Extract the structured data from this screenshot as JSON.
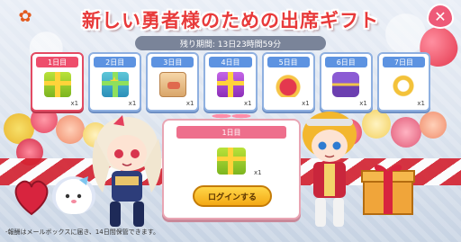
{
  "header": {
    "title": "新しい勇者様のための出席ギフト",
    "close_label": "✕"
  },
  "timer": {
    "text": "残り期間: 13日23時間59分"
  },
  "days": [
    {
      "label": "1日目",
      "qty": "x1",
      "gift": "green-gift-box",
      "active": true
    },
    {
      "label": "2日目",
      "qty": "x1",
      "gift": "teal-star-gift-box",
      "active": false
    },
    {
      "label": "3日目",
      "qty": "x1",
      "gift": "cardboard-box",
      "active": false
    },
    {
      "label": "4日目",
      "qty": "x1",
      "gift": "purple-star-gift-box",
      "active": false
    },
    {
      "label": "5日目",
      "qty": "x1",
      "gift": "red-pouch",
      "active": false
    },
    {
      "label": "6日目",
      "qty": "x1",
      "gift": "purple-treasure-chest",
      "active": false
    },
    {
      "label": "7日目",
      "qty": "x1",
      "gift": "gold-ring",
      "active": false
    }
  ],
  "reward": {
    "day_label": "1日目",
    "qty": "x1",
    "login_button": "ログインする"
  },
  "footer": {
    "note": "-報酬はメールボックスに届き、14日間保管できます。"
  },
  "colors": {
    "title": "#e83a3a",
    "active_day": "#ee4e6c",
    "day_tab": "#5d93e1",
    "button": "#f4a915"
  }
}
